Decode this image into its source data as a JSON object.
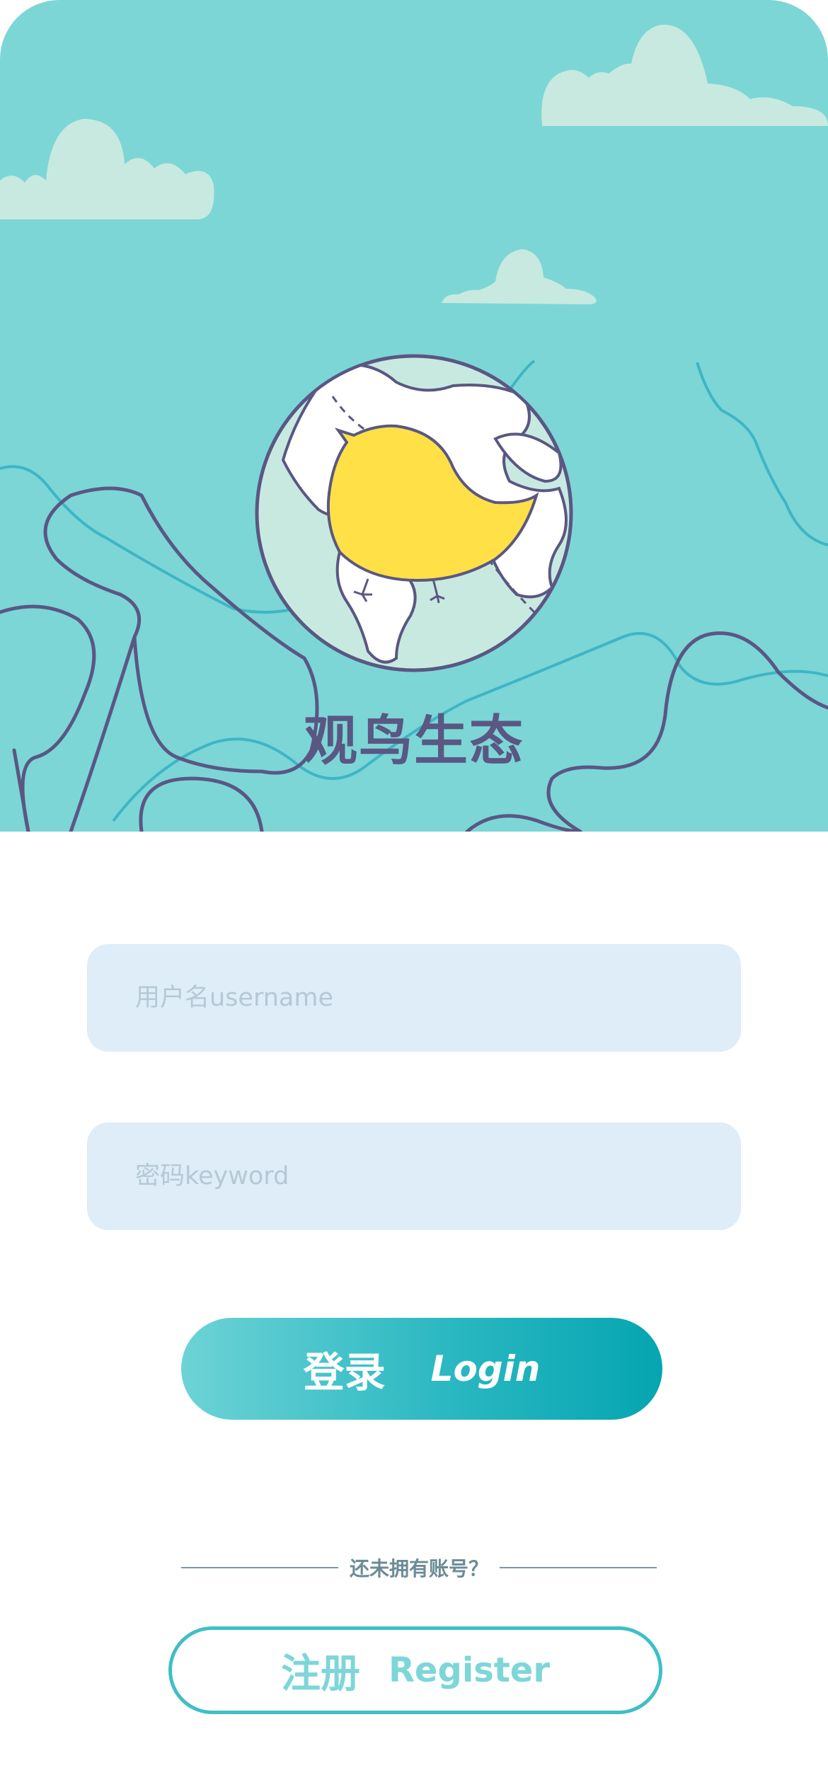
{
  "app": {
    "title": "观鸟生态"
  },
  "form": {
    "username_placeholder": "用户名username",
    "username_value": "",
    "password_placeholder": "密码keyword",
    "password_value": ""
  },
  "login_button": {
    "label_cn": "登录",
    "label_en": "Login"
  },
  "divider": {
    "text": "还未拥有账号？"
  },
  "register_button": {
    "label_cn": "注册",
    "label_en": "Register"
  },
  "colors": {
    "hero_background": "#7cd6d6",
    "cloud": "#c8e9e0",
    "outline": "#5a5783",
    "bird": "#ffe047",
    "input_background": "#deedf8",
    "accent": "#05a5b1"
  },
  "icons": {
    "logo": "globe-bird-icon"
  }
}
